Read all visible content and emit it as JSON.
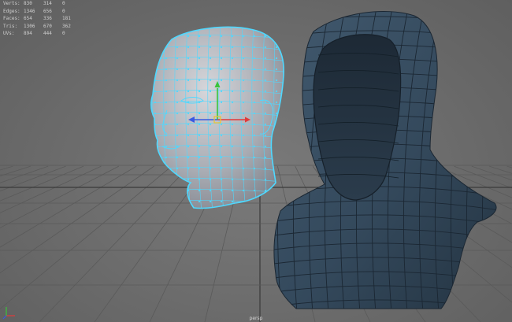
{
  "hud": {
    "rows": [
      {
        "label": "Verts:",
        "v1": "830",
        "v2": "314",
        "v3": "0"
      },
      {
        "label": "Edges:",
        "v1": "1346",
        "v2": "656",
        "v3": "0"
      },
      {
        "label": "Faces:",
        "v1": "654",
        "v2": "336",
        "v3": "181"
      },
      {
        "label": "Tris:",
        "v1": "1306",
        "v2": "670",
        "v3": "362"
      },
      {
        "label": "UVs:",
        "v1": "894",
        "v2": "444",
        "v3": "0"
      }
    ]
  },
  "camera": {
    "label": "persp"
  },
  "colors": {
    "viewport_bg": "#6e6e6e",
    "grid": "#5a5a5a",
    "grid_axis": "#3a3a3a",
    "selected_wire": "#4fd8ff",
    "head_shade": "#b2b4ba",
    "hood_shade": "#33495c",
    "hood_wire": "#1b2733",
    "manip_x": "#e23a3a",
    "manip_y": "#3ac43a",
    "manip_z": "#3a5ae2",
    "manip_center": "#e8c43a"
  },
  "icons": {
    "axis": "axis-indicator-icon",
    "manipulator": "move-manipulator-icon"
  }
}
